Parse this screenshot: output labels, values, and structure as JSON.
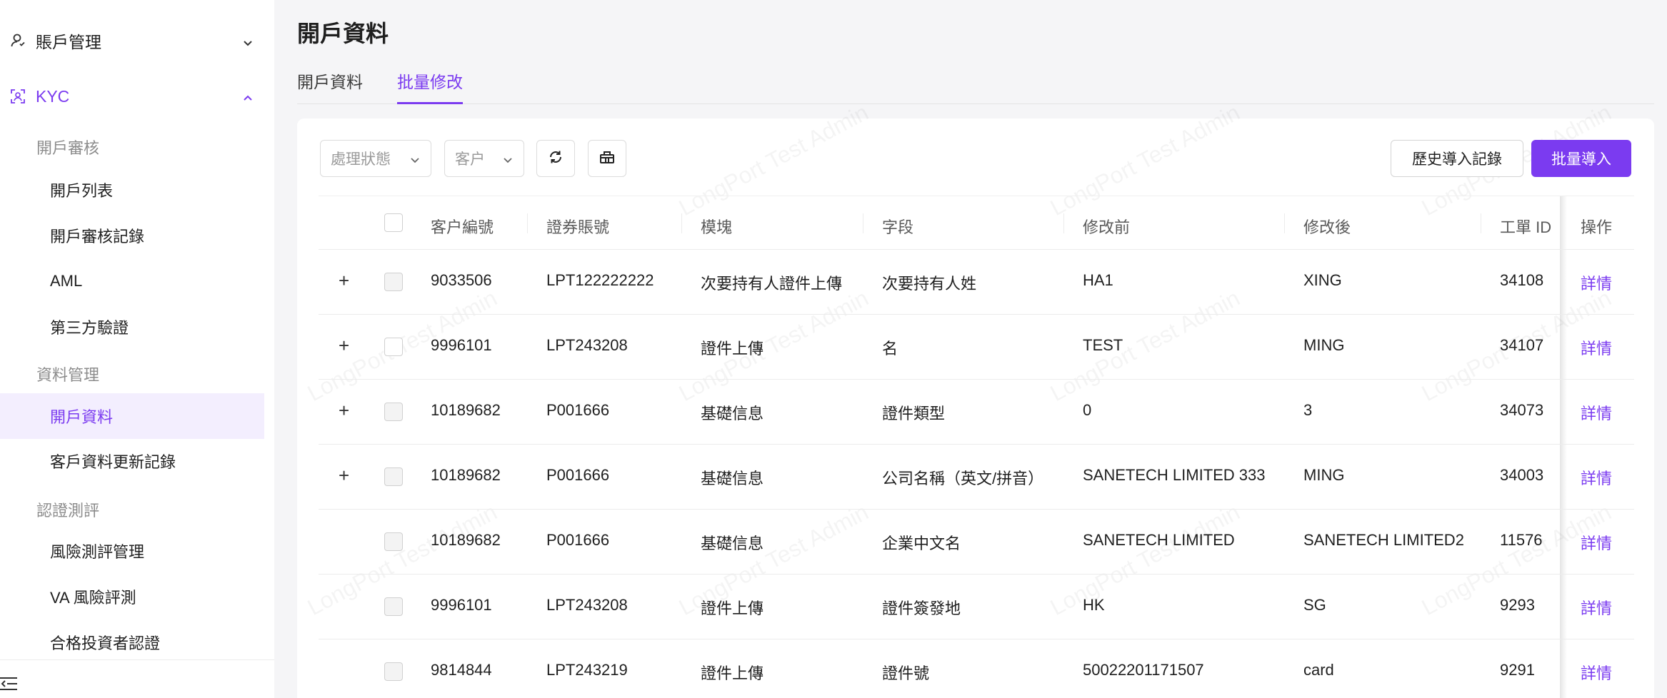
{
  "sidebar": {
    "account_mgmt": "賬戶管理",
    "kyc": "KYC",
    "sections": {
      "open_review": "開戶審核",
      "data_mgmt": "資料管理",
      "cert_eval": "認證測評"
    },
    "items": {
      "open_list": "開戶列表",
      "open_review_log": "開戶審核記錄",
      "aml": "AML",
      "third_party": "第三方驗證",
      "open_data": "開戶資料",
      "customer_update_log": "客戶資料更新記錄",
      "risk_eval": "風險測評管理",
      "va_risk": "VA 風險評測",
      "qualified_investor": "合格投資者認證"
    }
  },
  "page": {
    "title": "開戶資料",
    "tabs": [
      "開戶資料",
      "批量修改"
    ],
    "active_tab": 1
  },
  "toolbar": {
    "status_placeholder": "處理狀態",
    "customer_placeholder": "客户",
    "history_label": "歷史導入記錄",
    "import_label": "批量導入"
  },
  "watermark": "LongPort Test Admin",
  "table": {
    "headers": [
      "客户編號",
      "證券賬號",
      "模塊",
      "字段",
      "修改前",
      "修改後",
      "工單 ID",
      "操作"
    ],
    "rows": [
      {
        "customer": "9033506",
        "account": "LPT122222222",
        "module": "次要持有人證件上傳",
        "field": "次要持有人姓",
        "before": "HA1",
        "after": "XING",
        "ticket": "34108",
        "action": "詳情"
      },
      {
        "customer": "9996101",
        "account": "LPT243208",
        "module": "證件上傳",
        "field": "名",
        "before": "TEST",
        "after": "MING",
        "ticket": "34107",
        "action": "詳情"
      },
      {
        "customer": "10189682",
        "account": "P001666",
        "module": "基礎信息",
        "field": "證件類型",
        "before": "0",
        "after": "3",
        "ticket": "34073",
        "action": "詳情"
      },
      {
        "customer": "10189682",
        "account": "P001666",
        "module": "基礎信息",
        "field": "公司名稱（英文/拼音）",
        "before": "SANETECH LIMITED 333",
        "after": "MING",
        "ticket": "34003",
        "action": "詳情"
      },
      {
        "customer": "10189682",
        "account": "P001666",
        "module": "基礎信息",
        "field": "企業中文名",
        "before": "SANETECH LIMITED",
        "after": "SANETECH LIMITED2",
        "ticket": "11576",
        "action": "詳情"
      },
      {
        "customer": "9996101",
        "account": "LPT243208",
        "module": "證件上傳",
        "field": "證件簽發地",
        "before": "HK",
        "after": "SG",
        "ticket": "9293",
        "action": "詳情"
      },
      {
        "customer": "9814844",
        "account": "LPT243219",
        "module": "證件上傳",
        "field": "證件號",
        "before": "50022201171507",
        "after": "card",
        "ticket": "9291",
        "action": "詳情"
      }
    ],
    "expandable_rows": [
      true,
      true,
      true,
      true,
      false,
      false,
      false
    ]
  },
  "colors": {
    "accent": "#7b3bf0",
    "active_bg": "#f3eefe"
  }
}
